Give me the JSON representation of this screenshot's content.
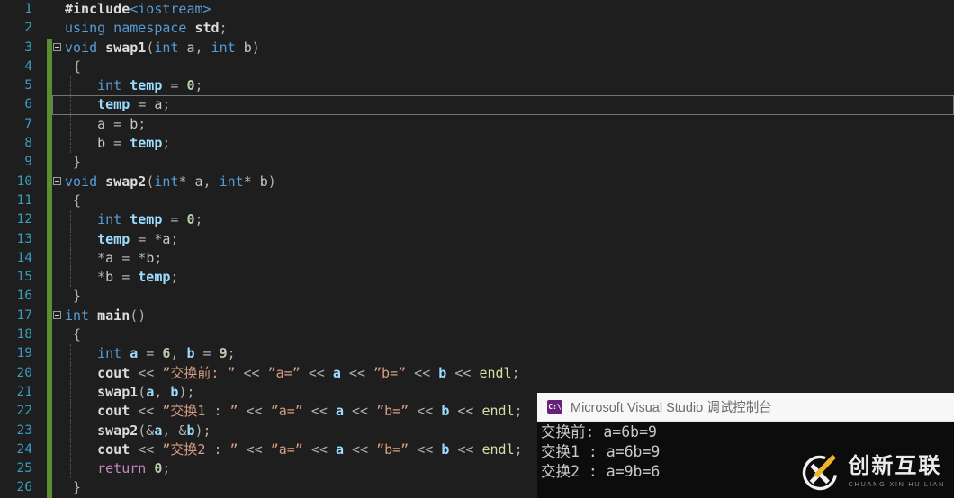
{
  "app": {
    "description": "Visual Studio dark-theme C++ editor with floating debug console"
  },
  "palette": {
    "editor_bg": "#1e1e1e",
    "keyword": "#569cd6",
    "control_keyword": "#c586c0",
    "variable": "#9cdcfe",
    "parameter": "#c8c8c8",
    "function_name": "#dcdcdc",
    "operator": "#b0b0b0",
    "string": "#d69d85",
    "number": "#b5cea8",
    "endl": "#dcdcaa",
    "line_number": "#3a9bbd",
    "change_bar_green": "#5a8e34",
    "current_line_border": "#747474",
    "console_bg": "#0c0c0c",
    "console_text": "#c9c9c9",
    "console_titlebar_bg": "#f7f7f7",
    "console_icon_bg": "#68217a",
    "logo_accent": "#f0b429"
  },
  "editor": {
    "current_line": 6,
    "lines": [
      {
        "n": 1,
        "bar": false,
        "fold": "",
        "dash": false,
        "t": [
          [
            "f",
            "#include"
          ],
          [
            "k",
            "<iostream>"
          ]
        ]
      },
      {
        "n": 2,
        "bar": false,
        "fold": "",
        "dash": false,
        "t": [
          [
            "k",
            "using namespace "
          ],
          [
            "f",
            "std"
          ],
          [
            "o",
            ";"
          ]
        ]
      },
      {
        "n": 3,
        "bar": true,
        "fold": "box",
        "dash": false,
        "t": [
          [
            "k",
            "void "
          ],
          [
            "f",
            "swap1"
          ],
          [
            "o",
            "("
          ],
          [
            "k",
            "int "
          ],
          [
            "p",
            "a"
          ],
          [
            "o",
            ", "
          ],
          [
            "k",
            "int "
          ],
          [
            "p",
            "b"
          ],
          [
            "o",
            ")"
          ]
        ]
      },
      {
        "n": 4,
        "bar": true,
        "fold": "bar",
        "dash": false,
        "t": [
          [
            "o",
            " {"
          ]
        ]
      },
      {
        "n": 5,
        "bar": true,
        "fold": "bar",
        "dash": true,
        "t": [
          [
            "o",
            "    "
          ],
          [
            "k",
            "int "
          ],
          [
            "v",
            "temp"
          ],
          [
            "o",
            " = "
          ],
          [
            "n",
            "0"
          ],
          [
            "o",
            ";"
          ]
        ]
      },
      {
        "n": 6,
        "bar": true,
        "fold": "bar",
        "dash": true,
        "t": [
          [
            "o",
            "    "
          ],
          [
            "v",
            "temp"
          ],
          [
            "o",
            " = "
          ],
          [
            "p",
            "a"
          ],
          [
            "o",
            ";"
          ]
        ]
      },
      {
        "n": 7,
        "bar": true,
        "fold": "bar",
        "dash": true,
        "t": [
          [
            "o",
            "    "
          ],
          [
            "p",
            "a"
          ],
          [
            "o",
            " = "
          ],
          [
            "p",
            "b"
          ],
          [
            "o",
            ";"
          ]
        ]
      },
      {
        "n": 8,
        "bar": true,
        "fold": "bar",
        "dash": true,
        "t": [
          [
            "o",
            "    "
          ],
          [
            "p",
            "b"
          ],
          [
            "o",
            " = "
          ],
          [
            "v",
            "temp"
          ],
          [
            "o",
            ";"
          ]
        ]
      },
      {
        "n": 9,
        "bar": true,
        "fold": "bar",
        "dash": false,
        "t": [
          [
            "o",
            " }"
          ]
        ]
      },
      {
        "n": 10,
        "bar": true,
        "fold": "box",
        "dash": false,
        "t": [
          [
            "k",
            "void "
          ],
          [
            "f",
            "swap2"
          ],
          [
            "o",
            "("
          ],
          [
            "k",
            "int"
          ],
          [
            "o",
            "* "
          ],
          [
            "p",
            "a"
          ],
          [
            "o",
            ", "
          ],
          [
            "k",
            "int"
          ],
          [
            "o",
            "* "
          ],
          [
            "p",
            "b"
          ],
          [
            "o",
            ")"
          ]
        ]
      },
      {
        "n": 11,
        "bar": true,
        "fold": "bar",
        "dash": false,
        "t": [
          [
            "o",
            " {"
          ]
        ]
      },
      {
        "n": 12,
        "bar": true,
        "fold": "bar",
        "dash": true,
        "t": [
          [
            "o",
            "    "
          ],
          [
            "k",
            "int "
          ],
          [
            "v",
            "temp"
          ],
          [
            "o",
            " = "
          ],
          [
            "n",
            "0"
          ],
          [
            "o",
            ";"
          ]
        ]
      },
      {
        "n": 13,
        "bar": true,
        "fold": "bar",
        "dash": true,
        "t": [
          [
            "o",
            "    "
          ],
          [
            "v",
            "temp"
          ],
          [
            "o",
            " = *"
          ],
          [
            "p",
            "a"
          ],
          [
            "o",
            ";"
          ]
        ]
      },
      {
        "n": 14,
        "bar": true,
        "fold": "bar",
        "dash": true,
        "t": [
          [
            "o",
            "    *"
          ],
          [
            "p",
            "a"
          ],
          [
            "o",
            " = *"
          ],
          [
            "p",
            "b"
          ],
          [
            "o",
            ";"
          ]
        ]
      },
      {
        "n": 15,
        "bar": true,
        "fold": "bar",
        "dash": true,
        "t": [
          [
            "o",
            "    *"
          ],
          [
            "p",
            "b"
          ],
          [
            "o",
            " = "
          ],
          [
            "v",
            "temp"
          ],
          [
            "o",
            ";"
          ]
        ]
      },
      {
        "n": 16,
        "bar": true,
        "fold": "bar",
        "dash": false,
        "t": [
          [
            "o",
            " }"
          ]
        ]
      },
      {
        "n": 17,
        "bar": true,
        "fold": "box",
        "dash": false,
        "t": [
          [
            "k",
            "int "
          ],
          [
            "f",
            "main"
          ],
          [
            "o",
            "()"
          ]
        ]
      },
      {
        "n": 18,
        "bar": true,
        "fold": "bar",
        "dash": false,
        "t": [
          [
            "o",
            " {"
          ]
        ]
      },
      {
        "n": 19,
        "bar": true,
        "fold": "bar",
        "dash": true,
        "t": [
          [
            "o",
            "    "
          ],
          [
            "k",
            "int "
          ],
          [
            "v",
            "a"
          ],
          [
            "o",
            " = "
          ],
          [
            "n",
            "6"
          ],
          [
            "o",
            ", "
          ],
          [
            "v",
            "b"
          ],
          [
            "o",
            " = "
          ],
          [
            "n",
            "9"
          ],
          [
            "o",
            ";"
          ]
        ]
      },
      {
        "n": 20,
        "bar": true,
        "fold": "bar",
        "dash": true,
        "t": [
          [
            "o",
            "    "
          ],
          [
            "f",
            "cout"
          ],
          [
            "o",
            " << "
          ],
          [
            "s",
            "”交换前: ”"
          ],
          [
            "o",
            " << "
          ],
          [
            "s",
            "”a=”"
          ],
          [
            "o",
            " << "
          ],
          [
            "v",
            "a"
          ],
          [
            "o",
            " << "
          ],
          [
            "s",
            "”b=”"
          ],
          [
            "o",
            " << "
          ],
          [
            "v",
            "b"
          ],
          [
            "o",
            " << "
          ],
          [
            "e",
            "endl"
          ],
          [
            "o",
            ";"
          ]
        ]
      },
      {
        "n": 21,
        "bar": true,
        "fold": "bar",
        "dash": true,
        "t": [
          [
            "o",
            "    "
          ],
          [
            "f",
            "swap1"
          ],
          [
            "o",
            "("
          ],
          [
            "v",
            "a"
          ],
          [
            "o",
            ", "
          ],
          [
            "v",
            "b"
          ],
          [
            "o",
            ");"
          ]
        ]
      },
      {
        "n": 22,
        "bar": true,
        "fold": "bar",
        "dash": true,
        "t": [
          [
            "o",
            "    "
          ],
          [
            "f",
            "cout"
          ],
          [
            "o",
            " << "
          ],
          [
            "s",
            "”交换1 : ”"
          ],
          [
            "o",
            " << "
          ],
          [
            "s",
            "”a=”"
          ],
          [
            "o",
            " << "
          ],
          [
            "v",
            "a"
          ],
          [
            "o",
            " << "
          ],
          [
            "s",
            "”b=”"
          ],
          [
            "o",
            " << "
          ],
          [
            "v",
            "b"
          ],
          [
            "o",
            " << "
          ],
          [
            "e",
            "endl"
          ],
          [
            "o",
            ";"
          ]
        ]
      },
      {
        "n": 23,
        "bar": true,
        "fold": "bar",
        "dash": true,
        "t": [
          [
            "o",
            "    "
          ],
          [
            "f",
            "swap2"
          ],
          [
            "o",
            "(&"
          ],
          [
            "v",
            "a"
          ],
          [
            "o",
            ", &"
          ],
          [
            "v",
            "b"
          ],
          [
            "o",
            ");"
          ]
        ]
      },
      {
        "n": 24,
        "bar": true,
        "fold": "bar",
        "dash": true,
        "t": [
          [
            "o",
            "    "
          ],
          [
            "f",
            "cout"
          ],
          [
            "o",
            " << "
          ],
          [
            "s",
            "”交换2 : ”"
          ],
          [
            "o",
            " << "
          ],
          [
            "s",
            "”a=”"
          ],
          [
            "o",
            " << "
          ],
          [
            "v",
            "a"
          ],
          [
            "o",
            " << "
          ],
          [
            "s",
            "”b=”"
          ],
          [
            "o",
            " << "
          ],
          [
            "v",
            "b"
          ],
          [
            "o",
            " << "
          ],
          [
            "e",
            "endl"
          ],
          [
            "o",
            ";"
          ]
        ]
      },
      {
        "n": 25,
        "bar": true,
        "fold": "bar",
        "dash": true,
        "t": [
          [
            "o",
            "    "
          ],
          [
            "c",
            "return "
          ],
          [
            "n",
            "0"
          ],
          [
            "o",
            ";"
          ]
        ]
      },
      {
        "n": 26,
        "bar": true,
        "fold": "bar",
        "dash": false,
        "t": [
          [
            "o",
            " }"
          ]
        ]
      }
    ]
  },
  "console": {
    "icon_label": "C:\\",
    "title": "Microsoft Visual Studio 调试控制台",
    "output": [
      "交换前: a=6b=9",
      "交换1 : a=6b=9",
      "交换2 : a=9b=6"
    ]
  },
  "watermark": {
    "name": "创新互联",
    "subtitle": "CHUANG XIN HU LIAN"
  }
}
